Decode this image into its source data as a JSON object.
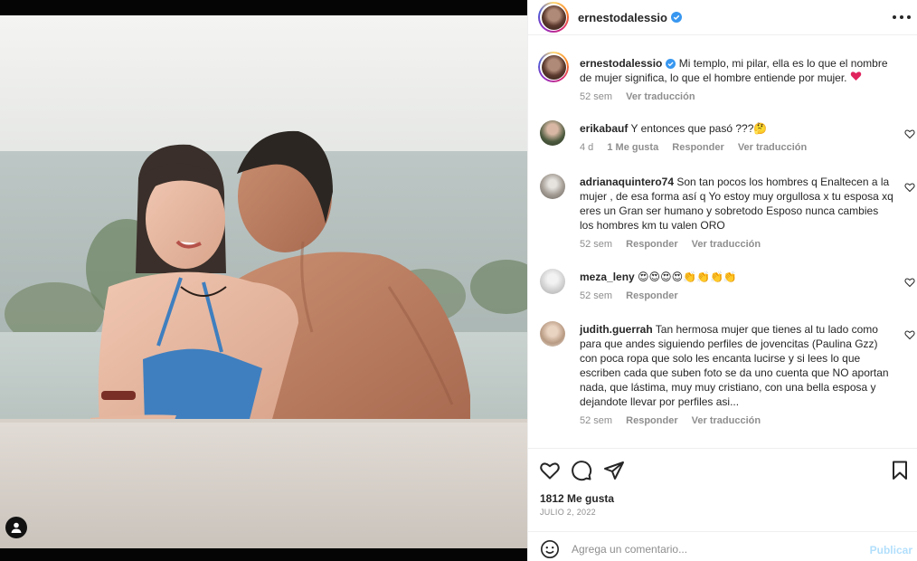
{
  "post": {
    "author": "ernestodalessio",
    "more_icon": "more-horizontal-icon"
  },
  "caption": {
    "user": "ernestodalessio",
    "text": "Mi templo, mi pilar, ella es lo que el nombre de mujer significa, lo que el hombre entiende por mujer.",
    "emoji": "❤️",
    "age": "52 sem",
    "translate": "Ver traducción"
  },
  "comments": [
    {
      "user": "erikabauf",
      "text": "Y entonces que pasó ???",
      "emoji": "🤔",
      "age": "4 d",
      "likes": "1 Me gusta",
      "reply": "Responder",
      "translate": "Ver traducción"
    },
    {
      "user": "adrianaquintero74",
      "text": "Son tan pocos los hombres q Enaltecen a la mujer , de esa forma así q Yo estoy muy orgullosa x tu esposa xq eres un Gran ser humano y sobretodo Esposo nunca cambies los hombres km tu valen ORO",
      "age": "52 sem",
      "reply": "Responder",
      "translate": "Ver traducción"
    },
    {
      "user": "meza_leny",
      "text": "",
      "emoji": "😍😍😍😍👏👏👏👏",
      "age": "52 sem",
      "reply": "Responder"
    },
    {
      "user": "judith.guerrah",
      "text": "Tan hermosa mujer que tienes al tu lado como para que andes siguiendo perfiles de jovencitas (Paulina Gzz) con poca ropa que solo les encanta lucirse y si lees lo que escriben cada que suben foto se da uno cuenta que NO aportan nada, que lástima, muy muy cristiano, con una bella esposa y dejandote llevar por perfiles asi...",
      "age": "52 sem",
      "reply": "Responder",
      "translate": "Ver traducción"
    }
  ],
  "actions": {
    "like_icon": "heart-icon",
    "comment_icon": "comment-icon",
    "share_icon": "send-icon",
    "save_icon": "bookmark-icon"
  },
  "likes_count": "1812 Me gusta",
  "date": "JULIO 2, 2022",
  "add_comment": {
    "placeholder": "Agrega un comentario...",
    "post_label": "Publicar",
    "post_color": "#b2dffc"
  },
  "colors": {
    "verified": "#3897f0",
    "heart": "#ed4956",
    "muted": "#8e8e8e"
  }
}
